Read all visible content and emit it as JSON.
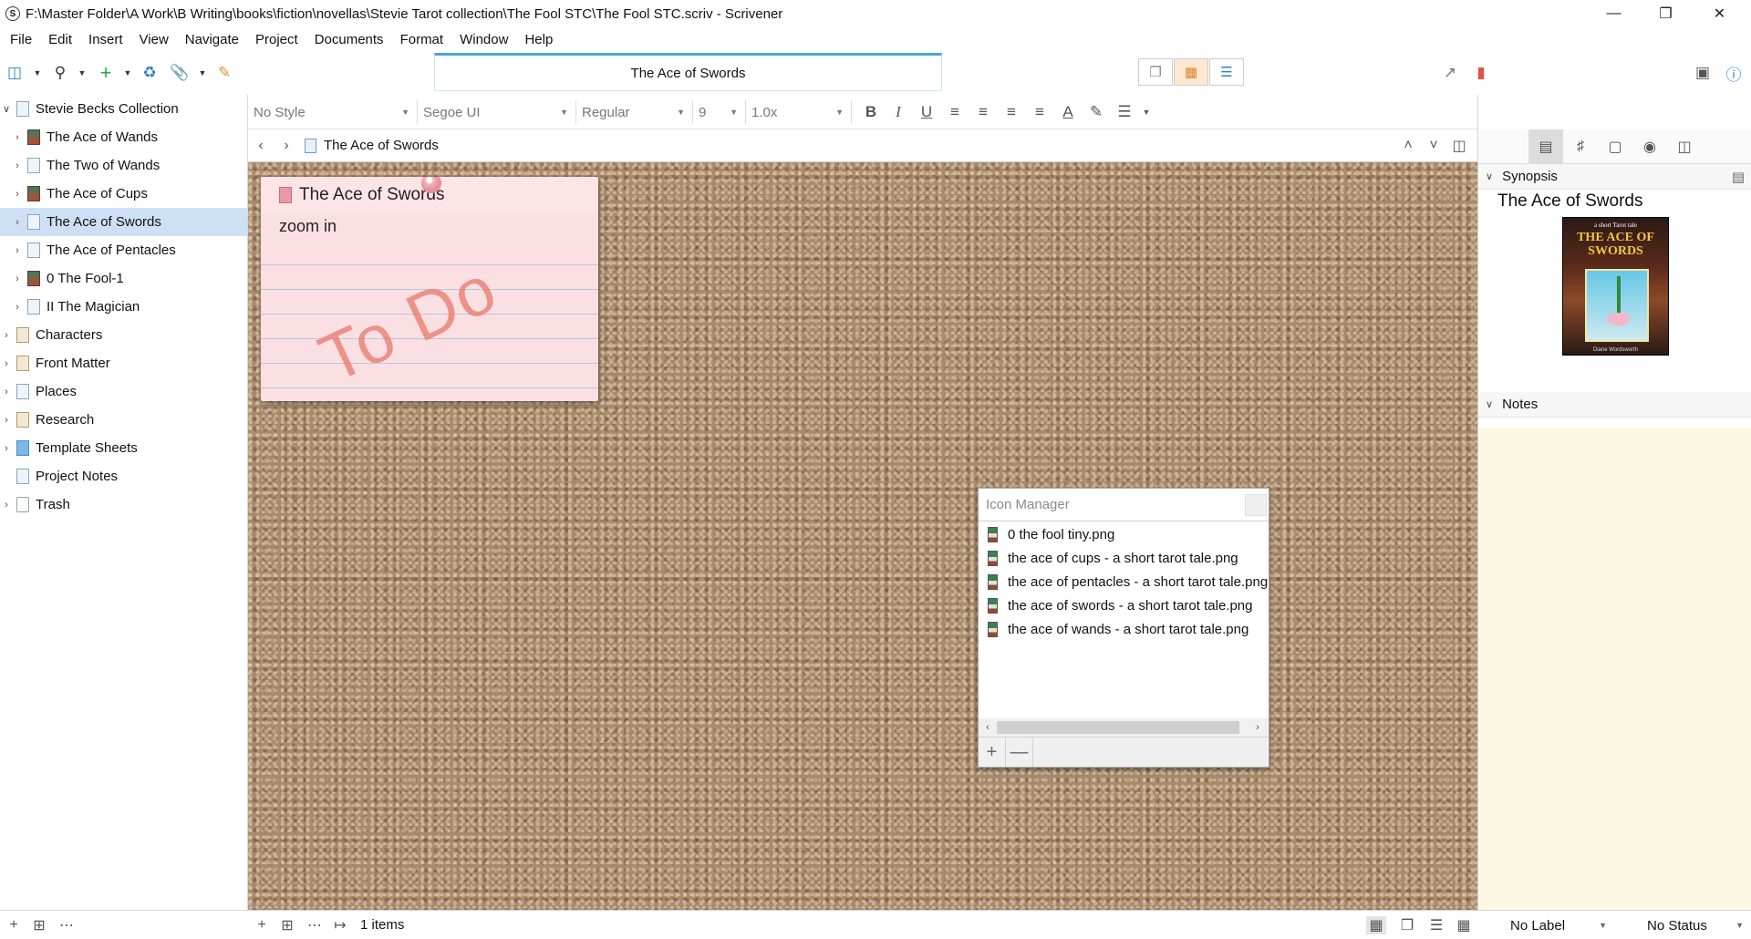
{
  "window": {
    "title": "F:\\Master Folder\\A Work\\B Writing\\books\\fiction\\novellas\\Stevie Tarot collection\\The Fool STC\\The Fool STC.scriv - Scrivener",
    "logo_letter": "S"
  },
  "menubar": [
    "File",
    "Edit",
    "Insert",
    "View",
    "Navigate",
    "Project",
    "Documents",
    "Format",
    "Window",
    "Help"
  ],
  "toolbar": {
    "document_title": "The Ace of Swords"
  },
  "binder": {
    "items": [
      {
        "label": "Stevie Becks Collection",
        "icon": "book-icon"
      },
      {
        "label": "The Ace of Wands",
        "icon": "card-icon"
      },
      {
        "label": "The Two of Wands",
        "icon": "document-icon"
      },
      {
        "label": "The Ace of Cups",
        "icon": "card-icon"
      },
      {
        "label": "The Ace of Swords",
        "icon": "document-icon",
        "selected": true
      },
      {
        "label": "The Ace of Pentacles",
        "icon": "document-icon"
      },
      {
        "label": "0 The Fool-1",
        "icon": "card-icon"
      },
      {
        "label": "II The Magician",
        "icon": "document-icon"
      },
      {
        "label": "Characters",
        "icon": "folder-icon"
      },
      {
        "label": "Front Matter",
        "icon": "folder-icon"
      },
      {
        "label": "Places",
        "icon": "document-icon"
      },
      {
        "label": "Research",
        "icon": "folder-icon"
      },
      {
        "label": "Template Sheets",
        "icon": "template-icon"
      },
      {
        "label": "Project Notes",
        "icon": "document-icon"
      },
      {
        "label": "Trash",
        "icon": "trash-icon"
      }
    ]
  },
  "formatbar": {
    "style": "No Style",
    "font": "Segoe UI",
    "weight": "Regular",
    "size": "9",
    "line_spacing": "1.0x"
  },
  "navbar": {
    "doc_title": "The Ace of Swords"
  },
  "corkboard": {
    "card": {
      "title": "The Ace of Swords",
      "synopsis": "zoom in",
      "stamp": "To Do"
    }
  },
  "icon_manager": {
    "title": "Icon Manager",
    "files": [
      "0 the fool tiny.png",
      "the ace of cups - a short tarot tale.png",
      "the ace of pentacles - a short tarot tale.png",
      "the ace of swords - a short tarot tale.png",
      "the ace of wands - a short tarot tale.png"
    ],
    "add": "+",
    "remove": "—"
  },
  "inspector": {
    "synopsis_header": "Synopsis",
    "synopsis_title": "The Ace of Swords",
    "cover": {
      "tagline": "a short Tarot tale",
      "title": "THE ACE OF SWORDS",
      "author": "Diane Wordsworth"
    },
    "notes_header": "Notes"
  },
  "bottombar": {
    "items_count": "1 items",
    "label": "No Label",
    "status": "No Status"
  },
  "colors": {
    "selection": "#cde0f5",
    "accent": "#2a7fc9",
    "card_pink": "#fbe0e3",
    "stamp": "#e87869",
    "notes_bg": "#fdf8e2"
  }
}
